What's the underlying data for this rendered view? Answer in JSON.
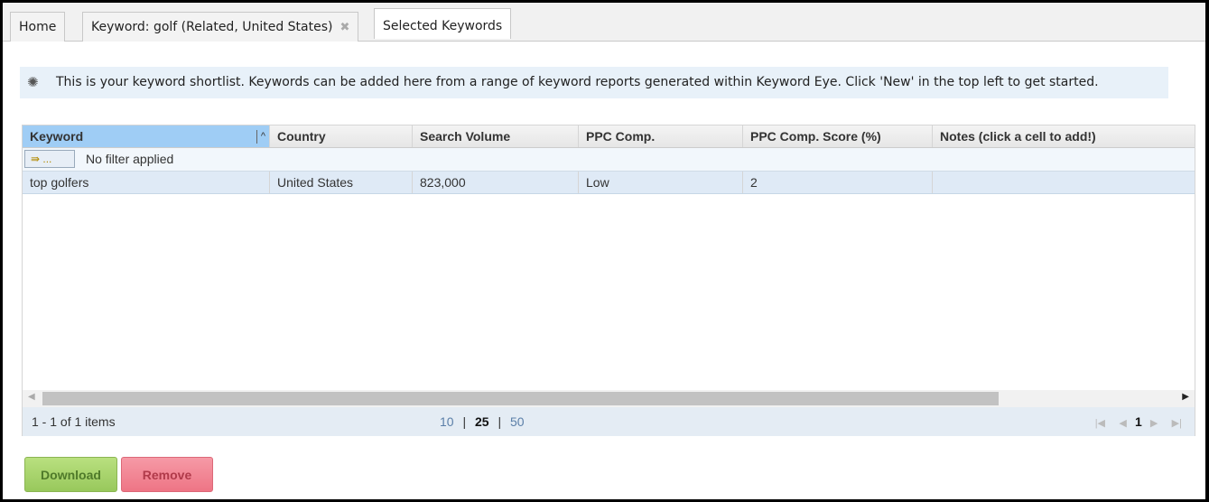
{
  "tabs": [
    {
      "label": "Home"
    },
    {
      "label": "Keyword: golf (Related, United States)",
      "close": "✖"
    },
    {
      "label": "Selected Keywords"
    }
  ],
  "info": {
    "icon": "lightbulb-icon",
    "text": "This is your keyword shortlist. Keywords can be added here from a range of keyword reports generated within Keyword Eye. Click 'New' in the top left to get started."
  },
  "grid": {
    "columns": [
      "Keyword",
      "Country",
      "Search Volume",
      "PPC Comp.",
      "PPC Comp. Score (%)",
      "Notes (click a cell to add!)"
    ],
    "sort_indicator": "^",
    "filter_button": "⇛ ...",
    "filter_text": "No filter applied",
    "rows": [
      [
        "top golfers",
        "United States",
        "823,000",
        "Low",
        "2",
        ""
      ]
    ]
  },
  "footer": {
    "items": "1 - 1 of 1 items",
    "sizes": [
      "10",
      "25",
      "50"
    ],
    "selected_size": "25",
    "page": "1"
  },
  "buttons": {
    "download": "Download",
    "remove": "Remove"
  },
  "colors": {
    "download": "#a8d672",
    "remove": "#f28a98",
    "selected_header": "#9fcdf5"
  }
}
